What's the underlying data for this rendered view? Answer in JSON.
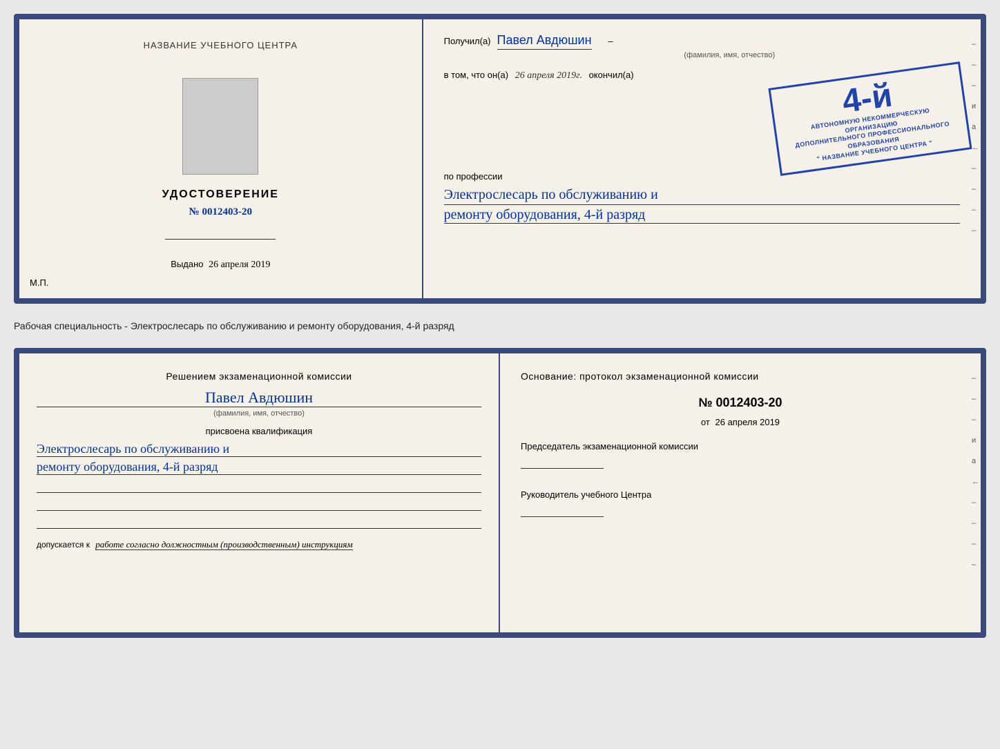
{
  "doc_top": {
    "left": {
      "center_title": "НАЗВАНИЕ УЧЕБНОГО ЦЕНТРА",
      "cert_label": "УДОСТОВЕРЕНИЕ",
      "cert_number": "№ 0012403-20",
      "issued_label": "Выдано",
      "issued_date": "26 апреля 2019",
      "mp_label": "М.П."
    },
    "right": {
      "recipient_prefix": "Получил(а)",
      "recipient_name": "Павел Авдюшин",
      "fio_hint": "(фамилия, имя, отчество)",
      "in_that_prefix": "в том, что он(а)",
      "in_that_date": "26 апреля 2019г.",
      "finished_label": "окончил(а)",
      "stamp_rank": "4-й",
      "stamp_line1": "АВТОНОМНУЮ НЕКОММЕРЧЕСКУЮ ОРГАНИЗАЦИЮ",
      "stamp_line2": "ДОПОЛНИТЕЛЬНОГО ПРОФЕССИОНАЛЬНОГО ОБРАЗОВАНИЯ",
      "stamp_line3": "\" НАЗВАНИЕ УЧЕБНОГО ЦЕНТРА \"",
      "profession_label": "по профессии",
      "profession_line1": "Электрослесарь по обслуживанию и",
      "profession_line2": "ремонту оборудования, 4-й разряд"
    }
  },
  "middle": {
    "text": "Рабочая специальность - Электрослесарь по обслуживанию и ремонту оборудования, 4-й разряд"
  },
  "doc_bottom": {
    "left": {
      "decision_title": "Решением экзаменационной комиссии",
      "name": "Павел Авдюшин",
      "fio_hint": "(фамилия, имя, отчество)",
      "qualification_label": "присвоена квалификация",
      "qualification_line1": "Электрослесарь по обслуживанию и",
      "qualification_line2": "ремонту оборудования, 4-й разряд",
      "admitted_prefix": "допускается к",
      "admitted_text": "работе согласно должностным (производственным) инструкциям"
    },
    "right": {
      "basis_title": "Основание: протокол экзаменационной комиссии",
      "protocol_number": "№ 0012403-20",
      "protocol_date_prefix": "от",
      "protocol_date": "26 апреля 2019",
      "chairman_label": "Председатель экзаменационной комиссии",
      "director_label": "Руководитель учебного Центра"
    }
  },
  "side_marks": [
    "-",
    "-",
    "-",
    "и",
    "а",
    "←",
    "-",
    "-",
    "-",
    "-"
  ],
  "side_marks_bottom": [
    "-",
    "-",
    "-",
    "и",
    "а",
    "←",
    "-",
    "-",
    "-",
    "-"
  ]
}
